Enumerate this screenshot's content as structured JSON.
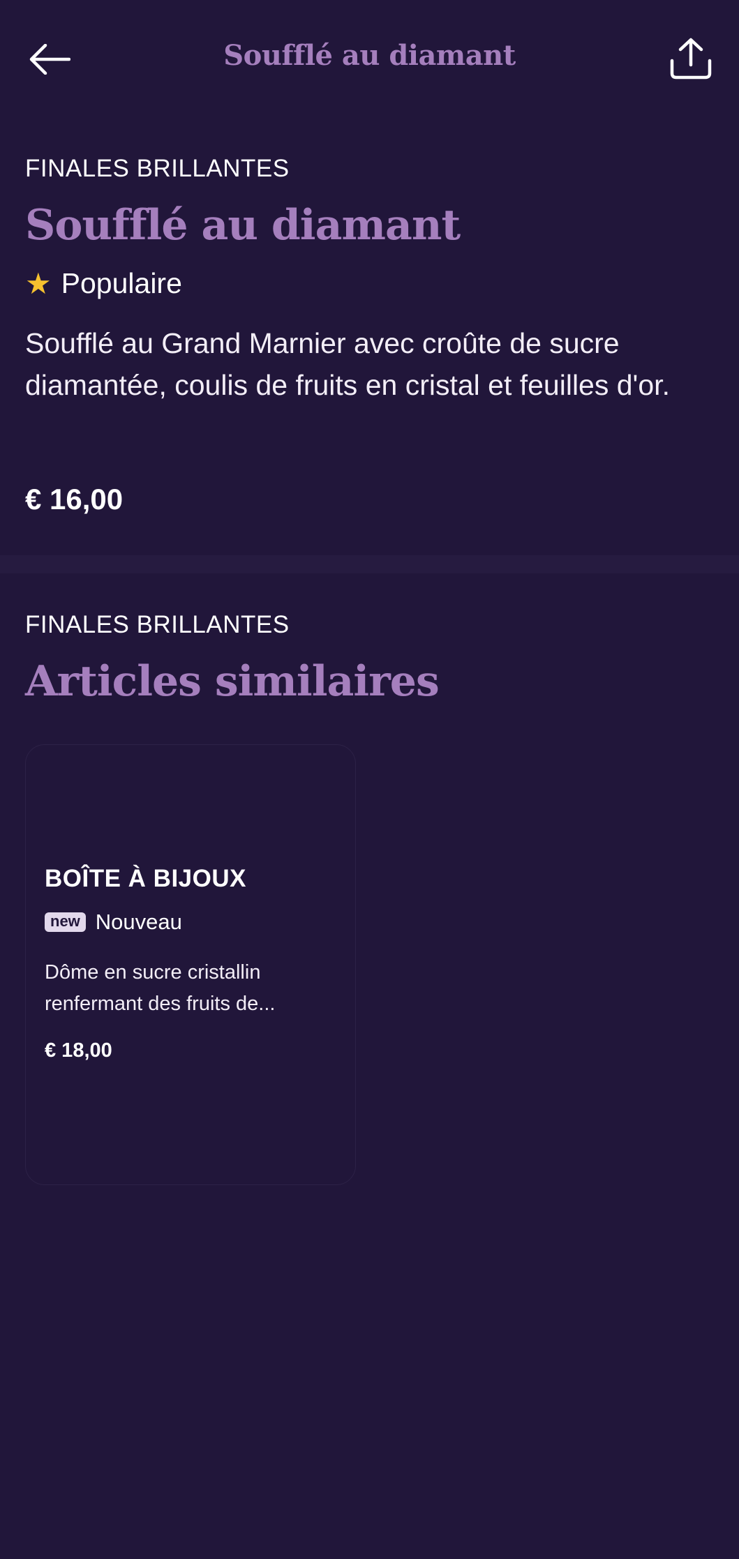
{
  "header": {
    "title": "Soufflé au diamant",
    "back_icon": "arrow-left-icon",
    "share_icon": "share-icon"
  },
  "item": {
    "category": "FINALES BRILLANTES",
    "name": "Soufflé au diamant",
    "badge_icon": "star-icon",
    "badge_label": "Populaire",
    "description": "Soufflé au Grand Marnier avec croûte de sucre diamantée, coulis de fruits en cristal et feuilles d'or.",
    "price": "€ 16,00"
  },
  "similar": {
    "category": "FINALES BRILLANTES",
    "title": "Articles similaires",
    "items": [
      {
        "name": "BOÎTE À BIJOUX",
        "badge_tag": "new",
        "badge_label": "Nouveau",
        "description": "Dôme en sucre cristallin renfermant des fruits de...",
        "price": "€ 18,00"
      }
    ]
  },
  "colors": {
    "background": "#21163a",
    "accent": "#a57fbd",
    "star": "#f6c12f",
    "badge_bg": "#e2d8ec"
  }
}
